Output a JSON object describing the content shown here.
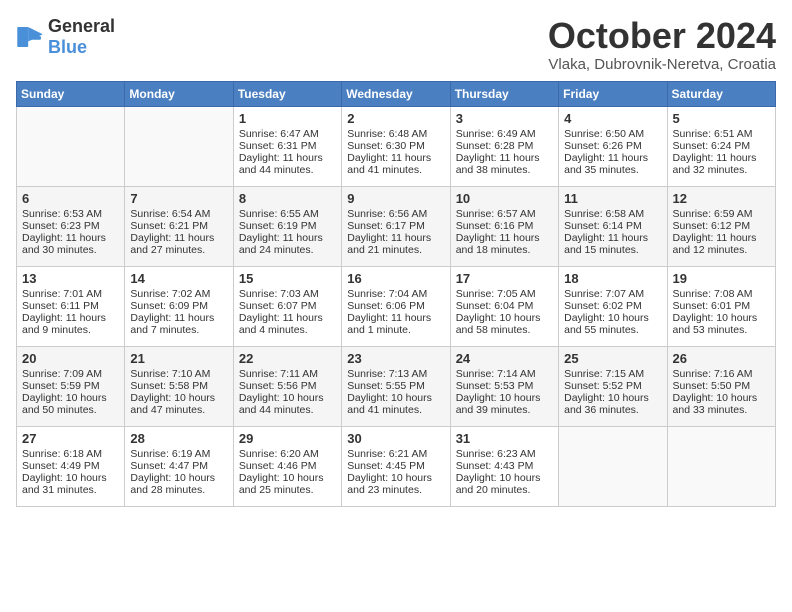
{
  "header": {
    "logo_general": "General",
    "logo_blue": "Blue",
    "month": "October 2024",
    "location": "Vlaka, Dubrovnik-Neretva, Croatia"
  },
  "days_of_week": [
    "Sunday",
    "Monday",
    "Tuesday",
    "Wednesday",
    "Thursday",
    "Friday",
    "Saturday"
  ],
  "weeks": [
    [
      {
        "day": "",
        "sunrise": "",
        "sunset": "",
        "daylight": ""
      },
      {
        "day": "",
        "sunrise": "",
        "sunset": "",
        "daylight": ""
      },
      {
        "day": "1",
        "sunrise": "Sunrise: 6:47 AM",
        "sunset": "Sunset: 6:31 PM",
        "daylight": "Daylight: 11 hours and 44 minutes."
      },
      {
        "day": "2",
        "sunrise": "Sunrise: 6:48 AM",
        "sunset": "Sunset: 6:30 PM",
        "daylight": "Daylight: 11 hours and 41 minutes."
      },
      {
        "day": "3",
        "sunrise": "Sunrise: 6:49 AM",
        "sunset": "Sunset: 6:28 PM",
        "daylight": "Daylight: 11 hours and 38 minutes."
      },
      {
        "day": "4",
        "sunrise": "Sunrise: 6:50 AM",
        "sunset": "Sunset: 6:26 PM",
        "daylight": "Daylight: 11 hours and 35 minutes."
      },
      {
        "day": "5",
        "sunrise": "Sunrise: 6:51 AM",
        "sunset": "Sunset: 6:24 PM",
        "daylight": "Daylight: 11 hours and 32 minutes."
      }
    ],
    [
      {
        "day": "6",
        "sunrise": "Sunrise: 6:53 AM",
        "sunset": "Sunset: 6:23 PM",
        "daylight": "Daylight: 11 hours and 30 minutes."
      },
      {
        "day": "7",
        "sunrise": "Sunrise: 6:54 AM",
        "sunset": "Sunset: 6:21 PM",
        "daylight": "Daylight: 11 hours and 27 minutes."
      },
      {
        "day": "8",
        "sunrise": "Sunrise: 6:55 AM",
        "sunset": "Sunset: 6:19 PM",
        "daylight": "Daylight: 11 hours and 24 minutes."
      },
      {
        "day": "9",
        "sunrise": "Sunrise: 6:56 AM",
        "sunset": "Sunset: 6:17 PM",
        "daylight": "Daylight: 11 hours and 21 minutes."
      },
      {
        "day": "10",
        "sunrise": "Sunrise: 6:57 AM",
        "sunset": "Sunset: 6:16 PM",
        "daylight": "Daylight: 11 hours and 18 minutes."
      },
      {
        "day": "11",
        "sunrise": "Sunrise: 6:58 AM",
        "sunset": "Sunset: 6:14 PM",
        "daylight": "Daylight: 11 hours and 15 minutes."
      },
      {
        "day": "12",
        "sunrise": "Sunrise: 6:59 AM",
        "sunset": "Sunset: 6:12 PM",
        "daylight": "Daylight: 11 hours and 12 minutes."
      }
    ],
    [
      {
        "day": "13",
        "sunrise": "Sunrise: 7:01 AM",
        "sunset": "Sunset: 6:11 PM",
        "daylight": "Daylight: 11 hours and 9 minutes."
      },
      {
        "day": "14",
        "sunrise": "Sunrise: 7:02 AM",
        "sunset": "Sunset: 6:09 PM",
        "daylight": "Daylight: 11 hours and 7 minutes."
      },
      {
        "day": "15",
        "sunrise": "Sunrise: 7:03 AM",
        "sunset": "Sunset: 6:07 PM",
        "daylight": "Daylight: 11 hours and 4 minutes."
      },
      {
        "day": "16",
        "sunrise": "Sunrise: 7:04 AM",
        "sunset": "Sunset: 6:06 PM",
        "daylight": "Daylight: 11 hours and 1 minute."
      },
      {
        "day": "17",
        "sunrise": "Sunrise: 7:05 AM",
        "sunset": "Sunset: 6:04 PM",
        "daylight": "Daylight: 10 hours and 58 minutes."
      },
      {
        "day": "18",
        "sunrise": "Sunrise: 7:07 AM",
        "sunset": "Sunset: 6:02 PM",
        "daylight": "Daylight: 10 hours and 55 minutes."
      },
      {
        "day": "19",
        "sunrise": "Sunrise: 7:08 AM",
        "sunset": "Sunset: 6:01 PM",
        "daylight": "Daylight: 10 hours and 53 minutes."
      }
    ],
    [
      {
        "day": "20",
        "sunrise": "Sunrise: 7:09 AM",
        "sunset": "Sunset: 5:59 PM",
        "daylight": "Daylight: 10 hours and 50 minutes."
      },
      {
        "day": "21",
        "sunrise": "Sunrise: 7:10 AM",
        "sunset": "Sunset: 5:58 PM",
        "daylight": "Daylight: 10 hours and 47 minutes."
      },
      {
        "day": "22",
        "sunrise": "Sunrise: 7:11 AM",
        "sunset": "Sunset: 5:56 PM",
        "daylight": "Daylight: 10 hours and 44 minutes."
      },
      {
        "day": "23",
        "sunrise": "Sunrise: 7:13 AM",
        "sunset": "Sunset: 5:55 PM",
        "daylight": "Daylight: 10 hours and 41 minutes."
      },
      {
        "day": "24",
        "sunrise": "Sunrise: 7:14 AM",
        "sunset": "Sunset: 5:53 PM",
        "daylight": "Daylight: 10 hours and 39 minutes."
      },
      {
        "day": "25",
        "sunrise": "Sunrise: 7:15 AM",
        "sunset": "Sunset: 5:52 PM",
        "daylight": "Daylight: 10 hours and 36 minutes."
      },
      {
        "day": "26",
        "sunrise": "Sunrise: 7:16 AM",
        "sunset": "Sunset: 5:50 PM",
        "daylight": "Daylight: 10 hours and 33 minutes."
      }
    ],
    [
      {
        "day": "27",
        "sunrise": "Sunrise: 6:18 AM",
        "sunset": "Sunset: 4:49 PM",
        "daylight": "Daylight: 10 hours and 31 minutes."
      },
      {
        "day": "28",
        "sunrise": "Sunrise: 6:19 AM",
        "sunset": "Sunset: 4:47 PM",
        "daylight": "Daylight: 10 hours and 28 minutes."
      },
      {
        "day": "29",
        "sunrise": "Sunrise: 6:20 AM",
        "sunset": "Sunset: 4:46 PM",
        "daylight": "Daylight: 10 hours and 25 minutes."
      },
      {
        "day": "30",
        "sunrise": "Sunrise: 6:21 AM",
        "sunset": "Sunset: 4:45 PM",
        "daylight": "Daylight: 10 hours and 23 minutes."
      },
      {
        "day": "31",
        "sunrise": "Sunrise: 6:23 AM",
        "sunset": "Sunset: 4:43 PM",
        "daylight": "Daylight: 10 hours and 20 minutes."
      },
      {
        "day": "",
        "sunrise": "",
        "sunset": "",
        "daylight": ""
      },
      {
        "day": "",
        "sunrise": "",
        "sunset": "",
        "daylight": ""
      }
    ]
  ]
}
